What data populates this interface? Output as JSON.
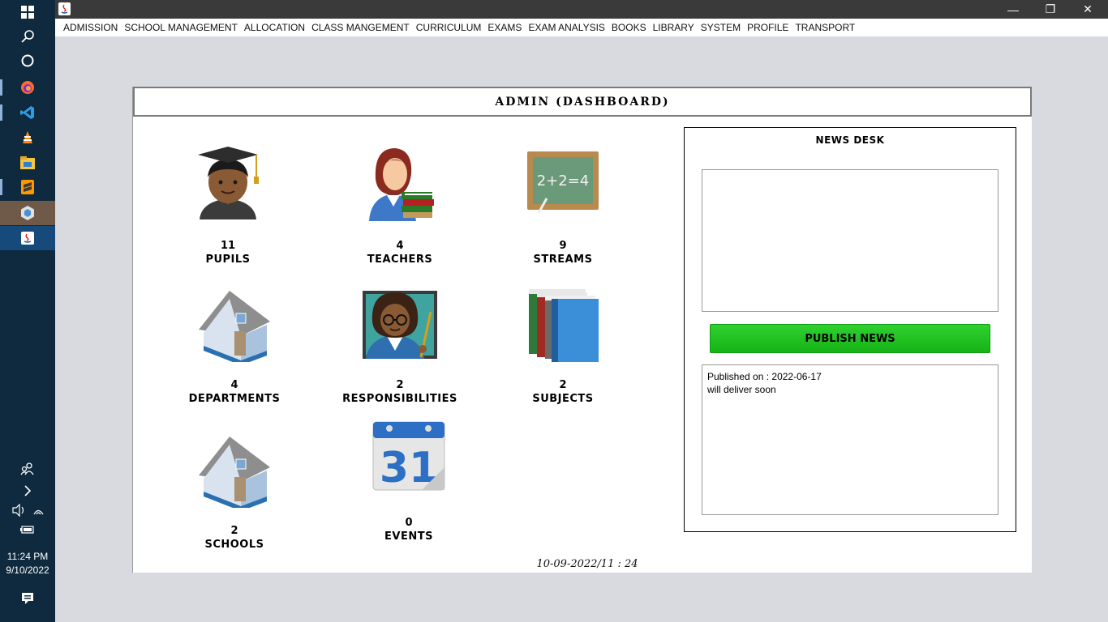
{
  "menu": [
    "ADMISSION",
    "SCHOOL MANAGEMENT",
    "ALLOCATION",
    "CLASS MANGEMENT",
    "CURRICULUM",
    "EXAMS",
    "EXAM ANALYSIS",
    "BOOKS",
    "LIBRARY",
    "SYSTEM",
    "PROFILE",
    "TRANSPORT"
  ],
  "window": {
    "minimize": "—",
    "restore": "❐",
    "close": "✕"
  },
  "dashboard": {
    "title": "ADMIN (DASHBOARD)",
    "tiles": {
      "pupils": {
        "count": "11",
        "label": "PUPILS"
      },
      "teachers": {
        "count": "4",
        "label": "TEACHERS"
      },
      "streams": {
        "count": "9",
        "label": "STREAMS"
      },
      "departments": {
        "count": "4",
        "label": "DEPARTMENTS"
      },
      "responsibilities": {
        "count": "2",
        "label": "RESPONSIBILITIES"
      },
      "subjects": {
        "count": "2",
        "label": "SUBJECTS"
      },
      "schools": {
        "count": "2",
        "label": "SCHOOLS"
      },
      "events": {
        "count": "0",
        "label": "EVENTS"
      }
    },
    "datetime": "10-09-2022/11 : 24",
    "calendar_day": "31",
    "chalkboard_text": "2+2=4"
  },
  "news": {
    "title": "NEWS DESK",
    "input_value": "",
    "publish_label": "PUBLISH NEWS",
    "published_on": "Published on : 2022-06-17",
    "message": "will deliver soon"
  },
  "taskbar": {
    "time": "11:24 PM",
    "date": "9/10/2022"
  },
  "colors": {
    "taskbar": "#0f2a3e",
    "publish_green": "#1fc21f",
    "titlebar": "#3a3a3a"
  }
}
